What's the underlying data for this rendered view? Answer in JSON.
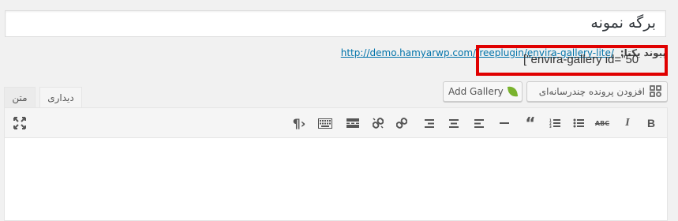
{
  "title": {
    "value": "برگه نمونه"
  },
  "permalink": {
    "label": "پیوند یکتا:",
    "url": "http://demo.hamyarwp.com/freeplugin/envira-gallery-lite/"
  },
  "buttons": {
    "add_media": "افزودن پرونده چندرسانه‌ای",
    "add_gallery": "Add Gallery"
  },
  "tabs": {
    "visual": "دیداری",
    "text": "متن"
  },
  "editor": {
    "shortcode": "[\"envira-gallery id=\"50",
    "highlight_color": "#e00000"
  },
  "toolbar_icons": [
    "bold-icon",
    "italic-icon",
    "strikethrough-icon",
    "bullet-list-icon",
    "numbered-list-icon",
    "blockquote-icon",
    "horizontal-line-icon",
    "align-left-icon",
    "align-center-icon",
    "align-right-icon",
    "insert-link-icon",
    "remove-link-icon",
    "read-more-icon",
    "toolbar-toggle-icon",
    "paragraph-rtl-icon",
    "fullscreen-icon"
  ]
}
